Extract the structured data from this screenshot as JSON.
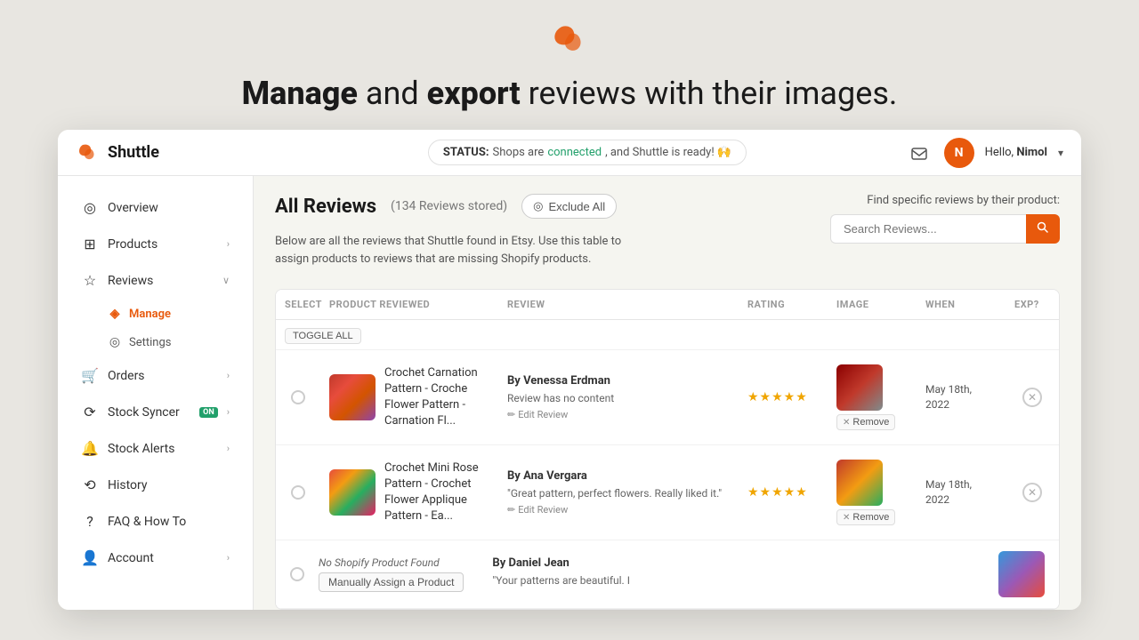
{
  "hero": {
    "title_part1": "Manage",
    "title_connector": " and ",
    "title_part2": "export",
    "title_rest": " reviews with their images."
  },
  "header": {
    "logo_text": "Shuttle",
    "status_label": "STATUS:",
    "status_text": "Shops are",
    "status_connected": "connected",
    "status_after": ", and Shuttle is ready! 🙌",
    "user_initial": "N",
    "greeting": "Hello,",
    "username": "Nimol"
  },
  "sidebar": {
    "items": [
      {
        "label": "Overview",
        "icon": "○"
      },
      {
        "label": "Products",
        "icon": "▦",
        "has_chevron": true
      },
      {
        "label": "Reviews",
        "icon": "☆",
        "has_chevron": true,
        "expanded": true
      },
      {
        "label": "Manage",
        "sub": true,
        "active": true
      },
      {
        "label": "Settings",
        "sub": true
      },
      {
        "label": "Orders",
        "icon": "🛒",
        "has_chevron": true
      },
      {
        "label": "Stock Syncer",
        "icon": "⟳",
        "badge": "ON",
        "has_chevron": true
      },
      {
        "label": "Stock Alerts",
        "icon": "🔔",
        "has_chevron": true
      },
      {
        "label": "History",
        "icon": "⟲"
      },
      {
        "label": "FAQ & How To",
        "icon": "?"
      },
      {
        "label": "Account",
        "icon": "👤",
        "has_chevron": true
      }
    ]
  },
  "main": {
    "page_title": "All Reviews",
    "reviews_count": "(134 Reviews stored)",
    "exclude_all": "Exclude All",
    "description": "Below are all the reviews that Shuttle found in Etsy. Use this table to assign products to reviews that are missing Shopify products.",
    "search_label": "Find specific reviews by their product:",
    "search_placeholder": "Search Reviews...",
    "columns": [
      "SELECT",
      "PRODUCT REVIEWED",
      "REVIEW",
      "RATING",
      "IMAGE",
      "WHEN",
      "EXP?"
    ],
    "toggle_all": "TOGGLE ALL",
    "reviews": [
      {
        "id": 1,
        "product": "Crochet Carnation Pattern - Croche Flower Pattern - Carnation Fl...",
        "author": "By Venessa Erdman",
        "review_text": "Review has no content",
        "stars": 5,
        "when": "May 18th, 2022",
        "edit_label": "Edit Review",
        "remove_label": "Remove",
        "has_image": true
      },
      {
        "id": 2,
        "product": "Crochet Mini Rose Pattern - Crochet Flower Applique Pattern - Ea...",
        "author": "By Ana Vergara",
        "review_text": "\"Great pattern, perfect flowers. Really liked it.\"",
        "stars": 5,
        "when": "May 18th, 2022",
        "edit_label": "Edit Review",
        "remove_label": "Remove",
        "has_image": true
      },
      {
        "id": 3,
        "product": null,
        "no_product_label": "No Shopify Product Found",
        "assign_label": "Manually Assign a Product",
        "author": "By Daniel Jean",
        "review_text": "\"Your patterns are beautiful. I",
        "stars": 0,
        "when": "",
        "has_image": true
      }
    ]
  }
}
